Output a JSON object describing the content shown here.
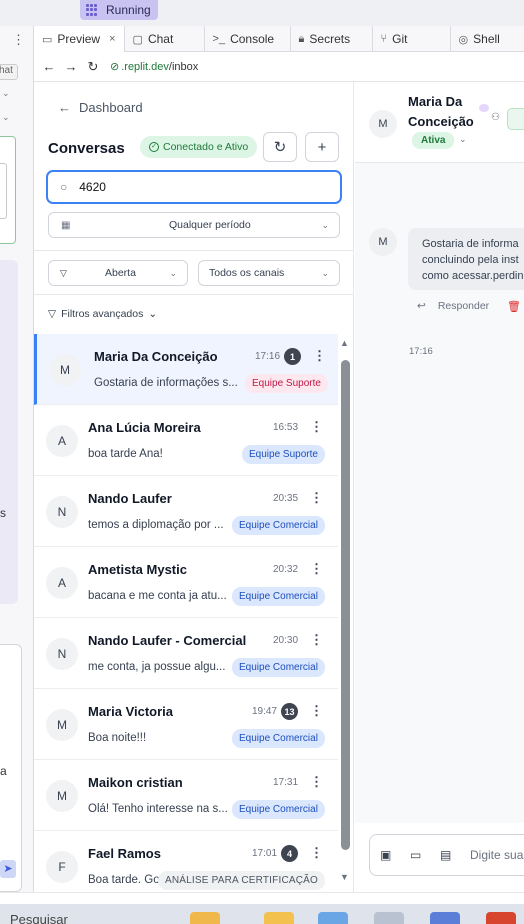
{
  "replit": {
    "running_label": "Running",
    "tabs": [
      {
        "label": "Preview",
        "icon": "monitor-icon"
      },
      {
        "label": "Chat",
        "icon": "chat-icon"
      },
      {
        "label": "Console",
        "icon": "terminal-icon"
      },
      {
        "label": "Secrets",
        "icon": "lock-icon"
      },
      {
        "label": "Git",
        "icon": "git-icon"
      },
      {
        "label": "Shell",
        "icon": "shell-icon"
      }
    ],
    "tab_close": "×",
    "url_host": ".replit.dev",
    "url_path": "/inbox",
    "left_chat_label": "hat",
    "left_s": "s",
    "left_a": "a"
  },
  "sidebar": {
    "back_label": "Dashboard",
    "title": "Conversas",
    "status_label": "Conectado e Ativo",
    "search_value": "4620",
    "period_label": "Qualquer período",
    "status_filter": "Aberta",
    "channel_filter": "Todos os canais",
    "advanced_filters": "Filtros avançados"
  },
  "conversations": [
    {
      "initial": "M",
      "name": "Maria Da Conceição",
      "time": "17:16",
      "unread": "1",
      "preview": "Gostaria de informações s...",
      "tag": "Equipe Suporte",
      "tag_style": "pink",
      "selected": true
    },
    {
      "initial": "A",
      "name": "Ana Lúcia Moreira",
      "time": "16:53",
      "unread": "",
      "preview": "boa tarde Ana!",
      "tag": "Equipe Suporte",
      "tag_style": "blue",
      "selected": false
    },
    {
      "initial": "N",
      "name": "Nando Laufer",
      "time": "20:35",
      "unread": "",
      "preview": "temos a diplomação por ...",
      "tag": "Equipe Comercial",
      "tag_style": "blue",
      "selected": false
    },
    {
      "initial": "A",
      "name": "Ametista Mystic",
      "time": "20:32",
      "unread": "",
      "preview": "bacana e me conta ja atu...",
      "tag": "Equipe Comercial",
      "tag_style": "blue",
      "selected": false
    },
    {
      "initial": "N",
      "name": "Nando Laufer - Comercial",
      "time": "20:30",
      "unread": "",
      "preview": "me conta, ja possue algu...",
      "tag": "Equipe Comercial",
      "tag_style": "blue",
      "selected": false
    },
    {
      "initial": "M",
      "name": "Maria Victoria",
      "time": "19:47",
      "unread": "13",
      "preview": "Boa noite!!!",
      "tag": "Equipe Comercial",
      "tag_style": "blue",
      "selected": false
    },
    {
      "initial": "M",
      "name": "Maikon cristian",
      "time": "17:31",
      "unread": "",
      "preview": "Olá! Tenho interesse na s...",
      "tag": "Equipe Comercial",
      "tag_style": "blue",
      "selected": false
    },
    {
      "initial": "F",
      "name": "Fael Ramos",
      "time": "17:01",
      "unread": "4",
      "preview": "Boa tarde. Gos...",
      "tag": "ANÁLISE PARA CERTIFICAÇÃO",
      "tag_style": "gray",
      "selected": false
    }
  ],
  "chat": {
    "initial": "M",
    "contact_name": "Maria Da Conceição",
    "status": "Ativa",
    "message_lines": [
      "Gostaria de informa",
      "concluindo pela inst",
      "como acessar.perdin"
    ],
    "reply_label": "Responder",
    "message_time": "17:16",
    "input_placeholder": "Digite sua"
  },
  "taskbar": {
    "search_label": "Pesquisar"
  },
  "colors": {
    "accent": "#3b82f6",
    "success": "#1f7a3a",
    "badge": "#3f4550"
  }
}
